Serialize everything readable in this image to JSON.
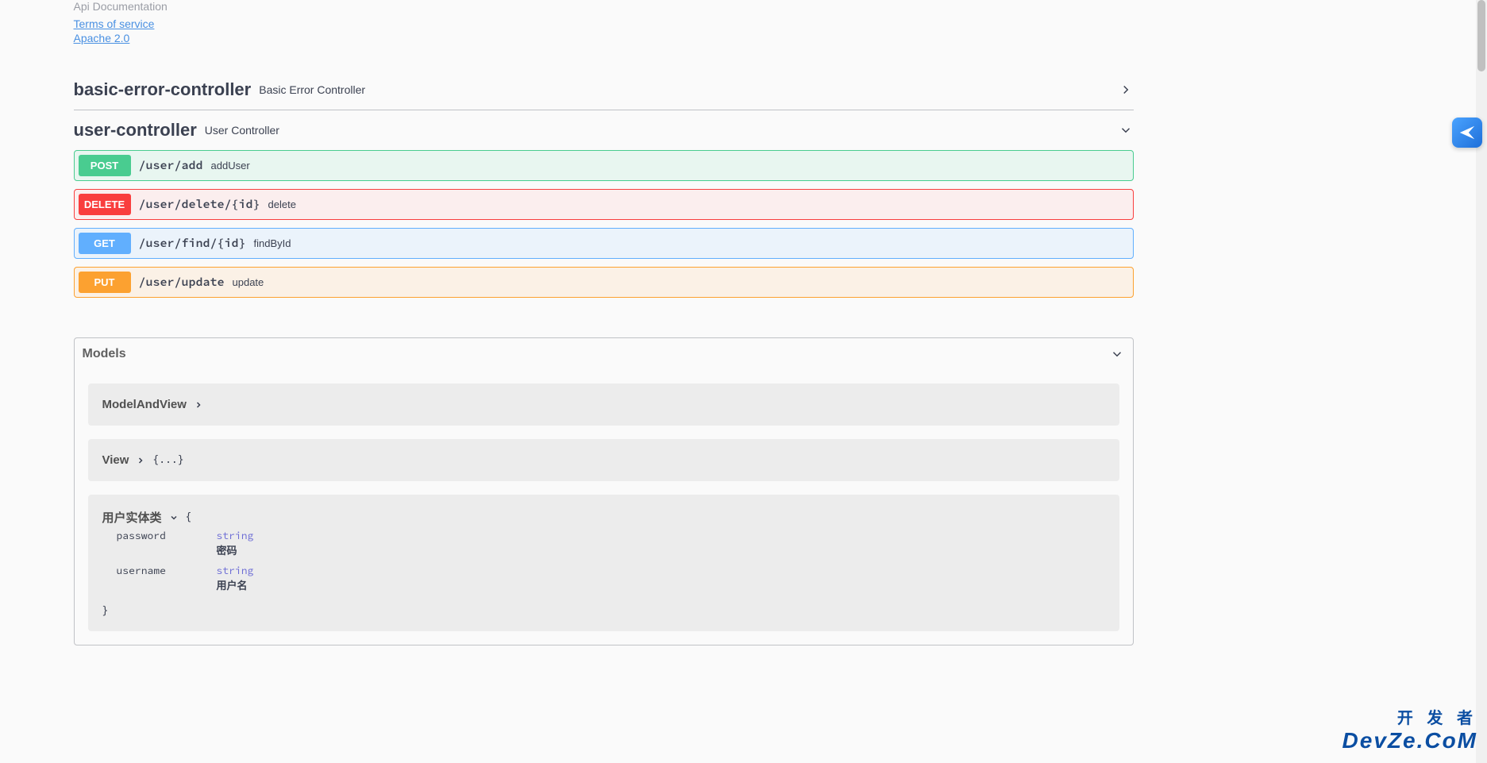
{
  "info": {
    "title": "Api Documentation",
    "terms_link": "Terms of service",
    "license_link": "Apache 2.0"
  },
  "tags": [
    {
      "name": "basic-error-controller",
      "desc": "Basic Error Controller",
      "expanded": false,
      "ops": []
    },
    {
      "name": "user-controller",
      "desc": "User Controller",
      "expanded": true,
      "ops": [
        {
          "method": "POST",
          "path": "/user/add",
          "summary": "addUser"
        },
        {
          "method": "DELETE",
          "path": "/user/delete/{id}",
          "summary": "delete"
        },
        {
          "method": "GET",
          "path": "/user/find/{id}",
          "summary": "findById"
        },
        {
          "method": "PUT",
          "path": "/user/update",
          "summary": "update"
        }
      ]
    }
  ],
  "models_header": "Models",
  "models": [
    {
      "name": "ModelAndView",
      "expanded": false
    },
    {
      "name": "View",
      "expanded": false,
      "inline": "{...}"
    },
    {
      "name": "用户实体类",
      "expanded": true,
      "properties": [
        {
          "key": "password",
          "type": "string",
          "desc": "密码"
        },
        {
          "key": "username",
          "type": "string",
          "desc": "用户名"
        }
      ]
    }
  ],
  "watermark": {
    "cn": "开 发 者",
    "en": "DevZe.CoM"
  }
}
